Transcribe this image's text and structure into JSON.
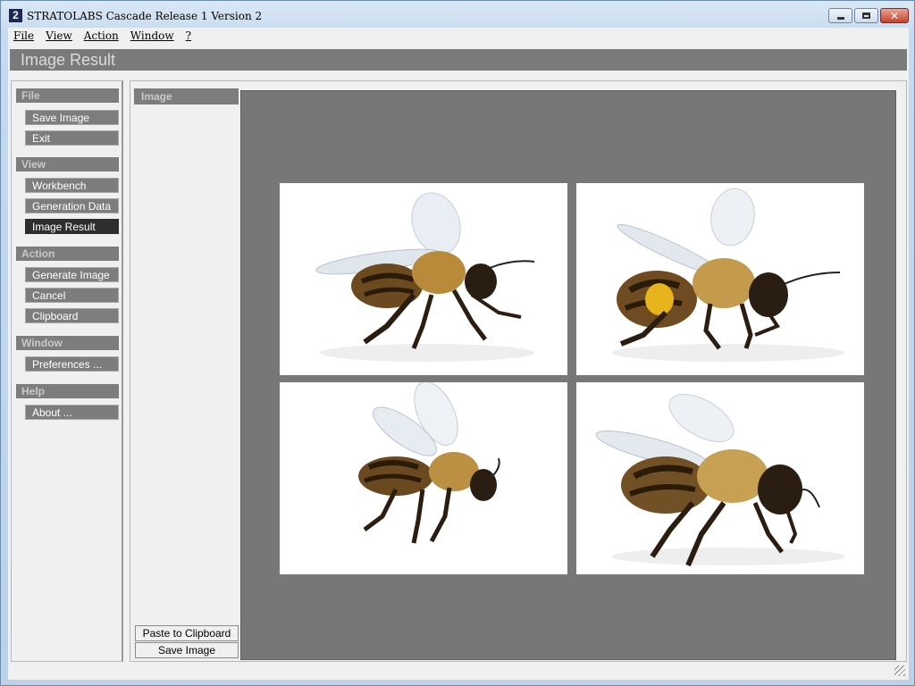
{
  "window": {
    "icon_glyph": "2",
    "title": "STRATOLABS Cascade Release 1 Version 2",
    "controls": [
      "minimize-icon",
      "maximize-icon",
      "close-icon"
    ]
  },
  "menu": {
    "file": "File",
    "view": "View",
    "action": "Action",
    "window": "Window",
    "help": "?"
  },
  "header": {
    "title": "Image Result"
  },
  "sidebar": {
    "sections": {
      "file": "File",
      "view": "View",
      "action": "Action",
      "window": "Window",
      "help": "Help"
    },
    "buttons": {
      "save_image": "Save Image",
      "exit": "Exit",
      "workbench": "Workbench",
      "generation_data": "Generation Data",
      "image_result": "Image Result",
      "generate_image": "Generate Image",
      "cancel": "Cancel",
      "clipboard": "Clipboard",
      "preferences": "Preferences ...",
      "about": "About ..."
    },
    "active": "image_result"
  },
  "main": {
    "panel_label": "Image",
    "images": [
      {
        "subject": "honeybee facing right, wings raised"
      },
      {
        "subject": "honeybee with yellow pollen basket facing right"
      },
      {
        "subject": "honeybee from side, wings up"
      },
      {
        "subject": "honeybee close-up facing right"
      }
    ],
    "paste_button": "Paste to Clipboard",
    "save_button": "Save Image"
  },
  "colors": {
    "panel_gray": "#7d7d7d",
    "canvas_gray": "#777777",
    "active_button": "#2e2e2e",
    "background": "#f0f0f0"
  }
}
